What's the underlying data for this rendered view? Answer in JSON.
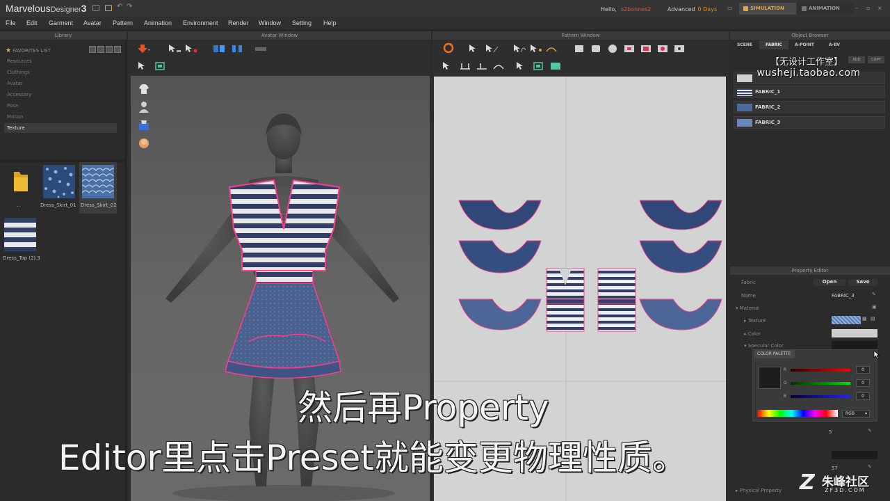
{
  "app": {
    "title": "Marvelous",
    "subtitle": "Designer",
    "version": "3",
    "hello_label": "Hello,",
    "user": "s2bonnes2",
    "edition": "Advanced",
    "days": "0 Days",
    "mode_simulation": "SIMULATION",
    "mode_animation": "ANIMATION"
  },
  "menu": [
    "File",
    "Edit",
    "Garment",
    "Avatar",
    "Pattern",
    "Animation",
    "Environment",
    "Render",
    "Window",
    "Setting",
    "Help"
  ],
  "library": {
    "header": "Library",
    "favorites": "FAVORITES LIST",
    "nav": [
      "Resources",
      "Clothings",
      "Avatar",
      "Accessory",
      "Pose",
      "Motion"
    ],
    "selected": "Texture",
    "thumbnails": [
      "..",
      "Dress_Skirt_01",
      "Dress_Skirt_02",
      "Dress_Top (2).3"
    ]
  },
  "avatar_window": {
    "header": "Avatar Window"
  },
  "pattern_window": {
    "header": "Pattern Window"
  },
  "object_browser": {
    "header": "Object Browser",
    "tabs": [
      "SCENE",
      "FABRIC",
      "A-POINT",
      "A-BV"
    ],
    "active_tab": "FABRIC",
    "buttons": [
      "ADD",
      "COPY"
    ],
    "fabrics": [
      "FABRIC_1",
      "FABRIC_2",
      "FABRIC_3"
    ]
  },
  "watermark": {
    "title": "【无设计工作室】",
    "url": "wusheji.taobao.com"
  },
  "property_editor": {
    "header": "Property Editor",
    "fabric_label": "Fabric",
    "open_label": "Open",
    "save_label": "Save",
    "name_label": "Name",
    "name_value": "FABRIC_3",
    "material_label": "Material",
    "texture_label": "Texture",
    "color_label": "Color",
    "specular_label": "Specular Color",
    "value_5": "5",
    "value_57": "57",
    "physical_label": "Physical Property"
  },
  "color_palette": {
    "title": "COLOR PALETTE",
    "r_label": "R",
    "g_label": "G",
    "b_label": "B",
    "r_value": "0",
    "g_value": "0",
    "b_value": "0",
    "mode": "RGB"
  },
  "subtitles": {
    "line1": "然后再Property",
    "line2": "Editor里点击Preset就能变更物理性质。"
  },
  "logo": {
    "mark": "Z",
    "name": "朱峰社区",
    "domain": "ZF3D.COM"
  },
  "colors": {
    "accent_orange": "#e38a1e",
    "stripe_navy": "#2f3f66",
    "stripe_white": "#e8e8ec",
    "denim_blue": "#4a6190",
    "outline_pink": "#ff3c8c"
  }
}
